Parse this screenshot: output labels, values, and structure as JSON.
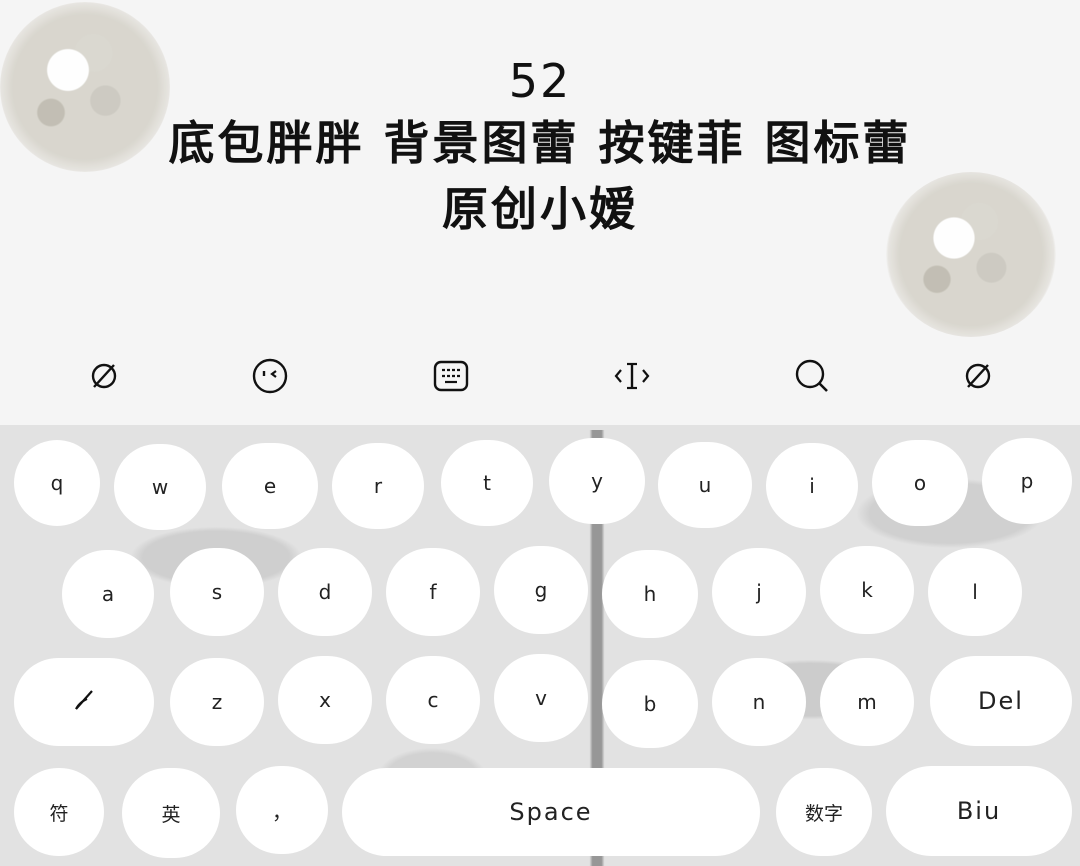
{
  "header": {
    "number": "52",
    "line1": "底包胖胖 背景图蕾 按键菲 图标蕾",
    "line2": "原创小嫒"
  },
  "toolbar": {
    "icons": [
      "empty-set-icon",
      "face-icon",
      "keyboard-icon",
      "text-cursor-icon",
      "search-icon",
      "empty-set-icon"
    ]
  },
  "keyboard": {
    "row1": [
      "q",
      "w",
      "e",
      "r",
      "t",
      "y",
      "u",
      "i",
      "o",
      "p"
    ],
    "row2": [
      "a",
      "s",
      "d",
      "f",
      "g",
      "h",
      "j",
      "k",
      "l"
    ],
    "row3": [
      "z",
      "x",
      "c",
      "v",
      "b",
      "n",
      "m"
    ],
    "del": "Del",
    "sym": "符",
    "lang": "英",
    "comma": "，",
    "space": "Space",
    "num": "数字",
    "enter": "Biu"
  },
  "colors": {
    "background": "#f5f5f5",
    "key": "#ffffff",
    "keyboard_bg": "#e2e2e2",
    "text": "#111111"
  }
}
